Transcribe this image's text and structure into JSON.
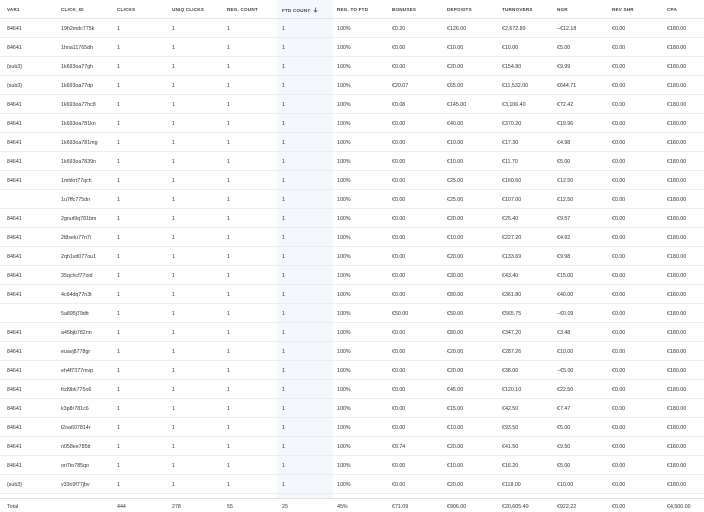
{
  "columns": [
    "VAR1",
    "CLICK_ID",
    "CLICKS",
    "UNIQ CLICKS",
    "REG. COUNT",
    "FTD COUNT",
    "REG. TO FTD",
    "BONUSES",
    "DEPOSITS",
    "TURNOVERS",
    "NGR",
    "REV SHR",
    "CPA"
  ],
  "sort_indicator": {
    "column": "FTD COUNT",
    "direction": "desc",
    "icon": "arrow-down-icon"
  },
  "rows": [
    [
      "84641",
      "19h2mdc775k",
      "1",
      "1",
      "1",
      "1",
      "100%",
      "€0.20",
      "€126.00",
      "€2,672.89",
      "−€12.18",
      "€0.00",
      "€180.00"
    ],
    [
      "84641",
      "1hna11765dh",
      "1",
      "1",
      "1",
      "1",
      "100%",
      "€0.00",
      "€10.00",
      "€10.00",
      "€5.00",
      "€0.00",
      "€180.00"
    ],
    [
      "{sub3}",
      "1k693oa77gh",
      "1",
      "1",
      "1",
      "1",
      "100%",
      "€0.00",
      "€20.00",
      "€154.80",
      "€9.99",
      "€0.00",
      "€180.00"
    ],
    [
      "{sub3}",
      "1k693oa77dp",
      "1",
      "1",
      "1",
      "1",
      "100%",
      "€20.07",
      "€65.00",
      "€11,532.00",
      "€644.71",
      "€0.00",
      "€180.00"
    ],
    [
      "84641",
      "1k693oa77hc8",
      "1",
      "1",
      "1",
      "1",
      "100%",
      "€0.08",
      "€145.00",
      "€3,106.40",
      "€72.42",
      "€0.00",
      "€180.00"
    ],
    [
      "84641",
      "1k693oa781kn",
      "1",
      "1",
      "1",
      "1",
      "100%",
      "€0.00",
      "€40.00",
      "€370.20",
      "€19.96",
      "€0.00",
      "€180.00"
    ],
    [
      "84641",
      "1k693oa781mg",
      "1",
      "1",
      "1",
      "1",
      "100%",
      "€0.00",
      "€10.00",
      "€17.30",
      "€4.98",
      "€0.00",
      "€180.00"
    ],
    [
      "84641",
      "1k693oa7839n",
      "1",
      "1",
      "1",
      "1",
      "100%",
      "€0.00",
      "€10.00",
      "€11.70",
      "€5.00",
      "€0.00",
      "€180.00"
    ],
    [
      "84641",
      "1mhkrt77qch",
      "1",
      "1",
      "1",
      "1",
      "100%",
      "€0.00",
      "€25.00",
      "€160.60",
      "€12.50",
      "€0.00",
      "€180.00"
    ],
    [
      "",
      "1u7ffc775dn",
      "1",
      "1",
      "1",
      "1",
      "100%",
      "€0.00",
      "€25.00",
      "€107.00",
      "€12.50",
      "€0.00",
      "€180.00"
    ],
    [
      "84641",
      "2gnut9q781bm",
      "1",
      "1",
      "1",
      "1",
      "100%",
      "€0.00",
      "€20.00",
      "€25.40",
      "€9.57",
      "€0.00",
      "€180.00"
    ],
    [
      "84641",
      "2t8selu77n7i",
      "1",
      "1",
      "1",
      "1",
      "100%",
      "€0.00",
      "€10.00",
      "€227.20",
      "€4.92",
      "€0.00",
      "€180.00"
    ],
    [
      "84641",
      "2qh1vd077ou1",
      "1",
      "1",
      "1",
      "1",
      "100%",
      "€0.00",
      "€20.00",
      "€133.69",
      "€9.98",
      "€0.00",
      "€180.00"
    ],
    [
      "84641",
      "35qchcf77oid",
      "1",
      "1",
      "1",
      "1",
      "100%",
      "€0.00",
      "€30.00",
      "€43.40",
      "€15.00",
      "€0.00",
      "€180.00"
    ],
    [
      "84641",
      "4c64dq77n3t",
      "1",
      "1",
      "1",
      "1",
      "100%",
      "€0.00",
      "€80.00",
      "€361.80",
      "€40.00",
      "€0.00",
      "€180.00"
    ],
    [
      "",
      "5a895j79dtt",
      "1",
      "1",
      "1",
      "1",
      "100%",
      "€50.00",
      "€50.00",
      "€565.75",
      "−€0.09",
      "€0.00",
      "€180.00"
    ],
    [
      "84641",
      "a45bjb782nn",
      "1",
      "1",
      "1",
      "1",
      "100%",
      "€0.00",
      "€80.00",
      "€347.20",
      "€3.48",
      "€0.00",
      "€180.00"
    ],
    [
      "84641",
      "euavj8778gr",
      "1",
      "1",
      "1",
      "1",
      "100%",
      "€0.00",
      "€20.00",
      "€287.26",
      "€10.00",
      "€0.00",
      "€180.00"
    ],
    [
      "84641",
      "eh4f7377mvp",
      "1",
      "1",
      "1",
      "1",
      "100%",
      "€0.00",
      "€20.00",
      "€38.00",
      "−€5.00",
      "€0.00",
      "€180.00"
    ],
    [
      "84641",
      "fcd9bk775o6",
      "1",
      "1",
      "1",
      "1",
      "100%",
      "€0.00",
      "€45.00",
      "€120.10",
      "€22.50",
      "€0.00",
      "€180.00"
    ],
    [
      "84641",
      "k3p8r781c6",
      "1",
      "1",
      "1",
      "1",
      "100%",
      "€0.00",
      "€15.00",
      "€42.50",
      "€7.47",
      "€0.00",
      "€180.00"
    ],
    [
      "84641",
      "l2oa607814r",
      "1",
      "1",
      "1",
      "1",
      "100%",
      "€0.00",
      "€10.00",
      "€93.50",
      "€5.00",
      "€0.00",
      "€180.00"
    ],
    [
      "84641",
      "n058ee785tt",
      "1",
      "1",
      "1",
      "1",
      "100%",
      "€0.74",
      "€20.00",
      "€41.50",
      "€9.50",
      "€0.00",
      "€180.00"
    ],
    [
      "84641",
      "ori7to785qo",
      "1",
      "1",
      "1",
      "1",
      "100%",
      "€0.00",
      "€10.00",
      "€16.20",
      "€5.00",
      "€0.00",
      "€180.00"
    ],
    [
      "{sub3}",
      "v33o9f77jbv",
      "1",
      "1",
      "1",
      "1",
      "100%",
      "€0.00",
      "€20.00",
      "€118.00",
      "€10.00",
      "€0.00",
      "€180.00"
    ]
  ],
  "total": [
    "Total",
    "",
    "444",
    "278",
    "55",
    "25",
    "45%",
    "€71.09",
    "€906.00",
    "€20,605.40",
    "€922.22",
    "€0.00",
    "€4,500.00"
  ]
}
